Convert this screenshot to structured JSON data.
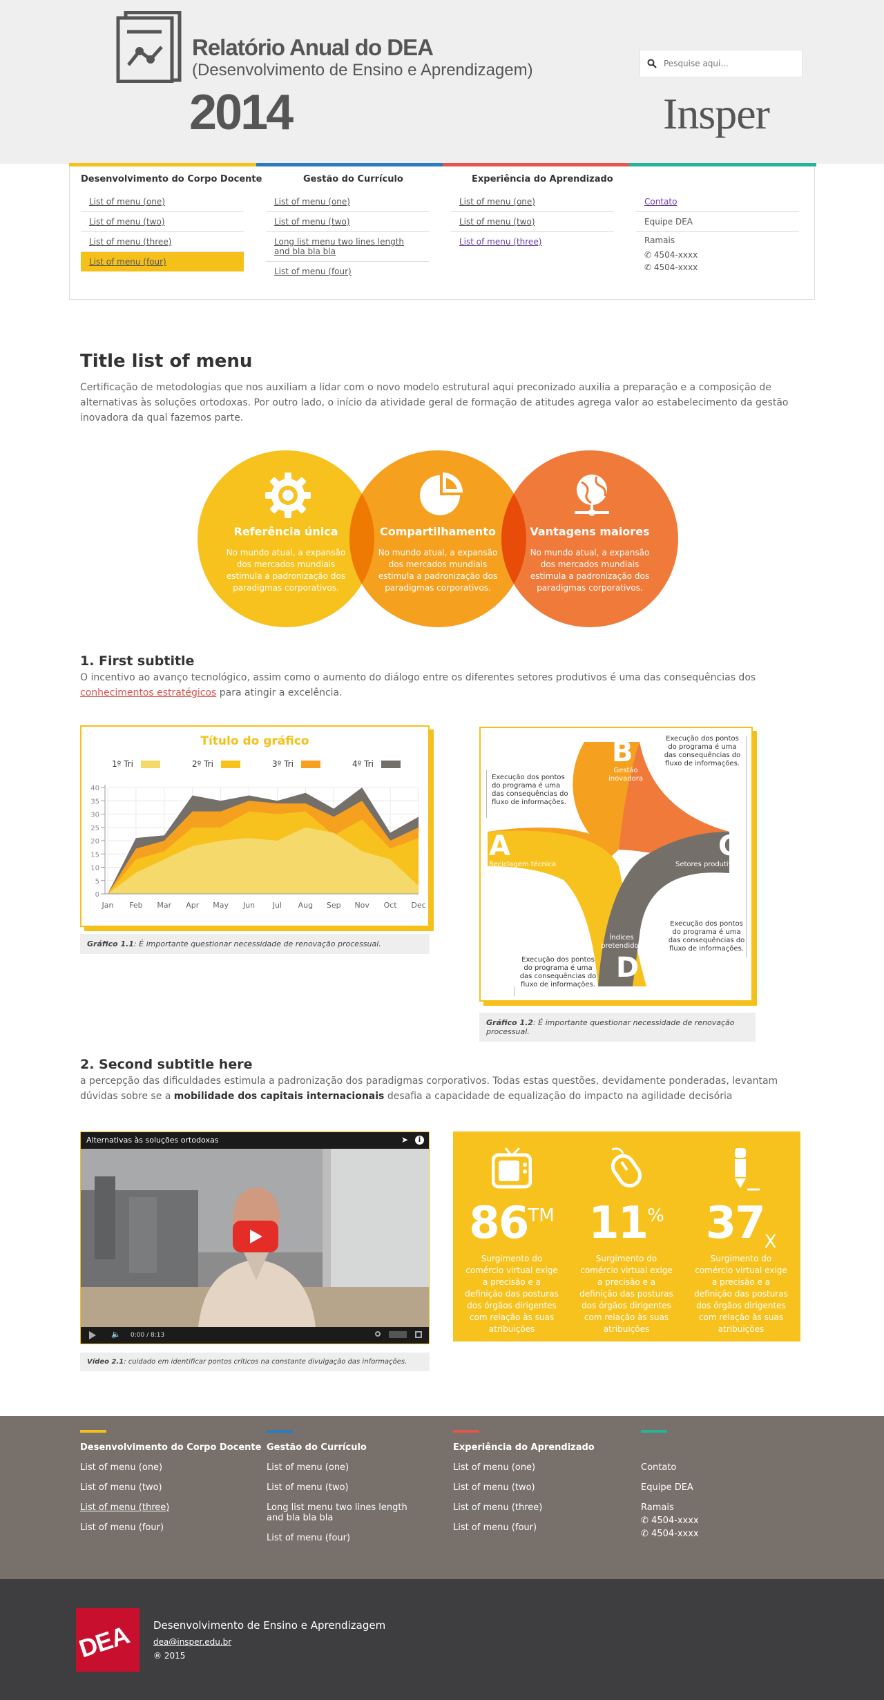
{
  "header": {
    "title": "Relatório Anual do DEA",
    "subtitle": "(Desenvolvimento de Ensino e Aprendizagem)",
    "year": "2014",
    "search_placeholder": "Pesquise aqui...",
    "partner_logo": "Insper"
  },
  "nav": {
    "colors": [
      "#f5c01a",
      "#2b7bbf",
      "#e2574c",
      "#27b39b"
    ],
    "col1": {
      "title": "Desenvolvimento do Corpo Docente",
      "items": [
        "List of menu (one)",
        "List of menu (two)",
        "List of menu (three)",
        "List of menu (four)"
      ]
    },
    "col2": {
      "title": "Gestão do Currículo",
      "items": [
        "List of menu (one)",
        "List of menu (two)",
        "Long list menu two lines length and bla bla bla",
        "List of menu (four)"
      ]
    },
    "col3": {
      "title": "Experiência do Aprendizado",
      "items": [
        "List of menu (one)",
        "List of menu (two)",
        "List of menu (three)"
      ]
    },
    "col4": {
      "items": [
        "Contato",
        "Equipe DEA"
      ],
      "ramais_label": "Ramais",
      "phones": [
        "4504-xxxx",
        "4504-xxxx"
      ]
    }
  },
  "main": {
    "title": "Title list of menu",
    "lead": "Certificação de metodologias que nos auxiliam a lidar com o novo modelo estrutural aqui preconizado auxilia a preparação e a composição de alternativas às soluções ortodoxas. Por outro lado, o início da atividade geral de formação de atitudes agrega valor ao estabelecimento da gestão inovadora da qual fazemos parte.",
    "circles": [
      {
        "title": "Referência única",
        "text": "No mundo atual, a expansão dos mercados mundiais estimula a padronização dos paradigmas corporativos.",
        "icon": "gear-icon",
        "color": "#f7c21d"
      },
      {
        "title": "Compartilhamento",
        "text": "No mundo atual, a expansão dos mercados mundiais estimula a padronização dos paradigmas corporativos.",
        "icon": "pie-chart-icon",
        "color": "#f6a020"
      },
      {
        "title": "Vantagens maiores",
        "text": "No mundo atual, a expansão dos mercados mundiais estimula a padronização dos paradigmas corporativos.",
        "icon": "globe-network-icon",
        "color": "#f07a3a"
      }
    ],
    "section1": {
      "title": "1.  First subtitle",
      "text_before": "O incentivo ao avanço tecnológico, assim como o aumento do diálogo entre os diferentes setores produtivos é uma das consequências dos ",
      "link": "conhecimentos estratégicos",
      "text_after": " para atingir a excelência.",
      "chart_caption_label": "Gráfico 1.1",
      "chart_caption": ": É importante questionar necessidade de renovação processual.",
      "diagram_caption_label": "Gráfico 1.2",
      "diagram_caption": ": É importante questionar necessidade de renovação processual."
    },
    "diagram": {
      "A": {
        "letter": "A",
        "label": "Reciclagem técnica"
      },
      "B": {
        "letter": "B",
        "label": "Gestão inovadora"
      },
      "C": {
        "letter": "C",
        "label": "Setores produtivo"
      },
      "D": {
        "letter": "D",
        "label": "Índices pretendidos"
      },
      "note": "Execução dos pontos do programa é uma das consequências do fluxo de informações."
    },
    "section2": {
      "title": "2.  Second subtitle here",
      "text_before": "a percepção das dificuldades estimula a padronização dos paradigmas corporativos. Todas estas questões, devidamente ponderadas, levantam dúvidas sobre se a ",
      "bold": "mobilidade dos capitais internacionais",
      "text_after": " desafia a capacidade de equalização do impacto na agilidade decisória",
      "video_title": "Alternativas às soluções ortodoxas",
      "video_time": "0:00 / 8:13",
      "video_caption_label": "Vídeo 2.1",
      "video_caption": ": cuidado em identificar pontos críticos na constante divulgação das informações."
    },
    "stats": [
      {
        "value": "86",
        "suffix": "TM",
        "suffix_type": "sup",
        "icon": "tv-icon",
        "text": "Surgimento do comércio virtual exige a precisão e a definição das posturas dos órgãos dirigentes com relação às suas atribuições"
      },
      {
        "value": "11",
        "suffix": "%",
        "suffix_type": "sup",
        "icon": "mouse-icon",
        "text": "Surgimento do comércio virtual exige a precisão e a definição das posturas dos órgãos dirigentes com relação às suas atribuições"
      },
      {
        "value": "37",
        "suffix": "X",
        "suffix_type": "sub",
        "icon": "pencil-icon",
        "text": "Surgimento do comércio virtual exige a precisão e a definição das posturas dos órgãos dirigentes com relação às suas atribuições"
      }
    ]
  },
  "chart_data": {
    "type": "area",
    "title": "Título do gráfico",
    "categories": [
      "Jan",
      "Feb",
      "Mar",
      "Apr",
      "May",
      "Jun",
      "Jul",
      "Aug",
      "Sep",
      "Nov",
      "Oct",
      "Dec"
    ],
    "ylim": [
      0,
      40
    ],
    "yticks": [
      0,
      5,
      10,
      15,
      20,
      25,
      30,
      35,
      40
    ],
    "legend_position": "top",
    "stacked": false,
    "series": [
      {
        "name": "4º Tri",
        "color": "#756f6a",
        "values": [
          0,
          21,
          22,
          37,
          35,
          37,
          35,
          38,
          32,
          40,
          23,
          29
        ]
      },
      {
        "name": "3º Tri",
        "color": "#f6a020",
        "values": [
          0,
          17,
          20,
          31,
          31,
          35,
          34,
          34,
          29,
          35,
          20,
          25
        ]
      },
      {
        "name": "2º Tri",
        "color": "#f7c21d",
        "values": [
          0,
          13,
          16,
          25,
          25,
          31,
          30,
          31,
          22,
          28,
          17,
          21
        ]
      },
      {
        "name": "1º Tri",
        "color": "#f5d96a",
        "values": [
          0,
          8,
          13,
          18,
          20,
          21,
          20,
          25,
          23,
          16,
          13,
          3
        ]
      }
    ]
  },
  "footer": {
    "col1": {
      "title": "Desenvolvimento do Corpo Docente",
      "items": [
        "List of menu (one)",
        "List of menu (two)",
        "List of menu (three)",
        "List of menu (four)"
      ]
    },
    "col2": {
      "title": "Gestão do Currículo",
      "items": [
        "List of menu (one)",
        "List of menu (two)",
        "Long list menu two lines length and bla bla bla",
        "List of menu (four)"
      ]
    },
    "col3": {
      "title": "Experiência do Aprendizado",
      "items": [
        "List of menu (one)",
        "List of menu (two)",
        "List of menu (three)",
        "List of menu (four)"
      ]
    },
    "col4": {
      "items": [
        "Contato",
        "Equipe DEA"
      ],
      "ramais_label": "Ramais",
      "phones": [
        "4504-xxxx",
        "4504-xxxx"
      ]
    }
  },
  "bottom": {
    "logo_text": "DEA",
    "org_name": "Desenvolvimento de Ensino e Aprendizagem",
    "email": "dea@insper.edu.br",
    "copyright": "® 2015"
  }
}
